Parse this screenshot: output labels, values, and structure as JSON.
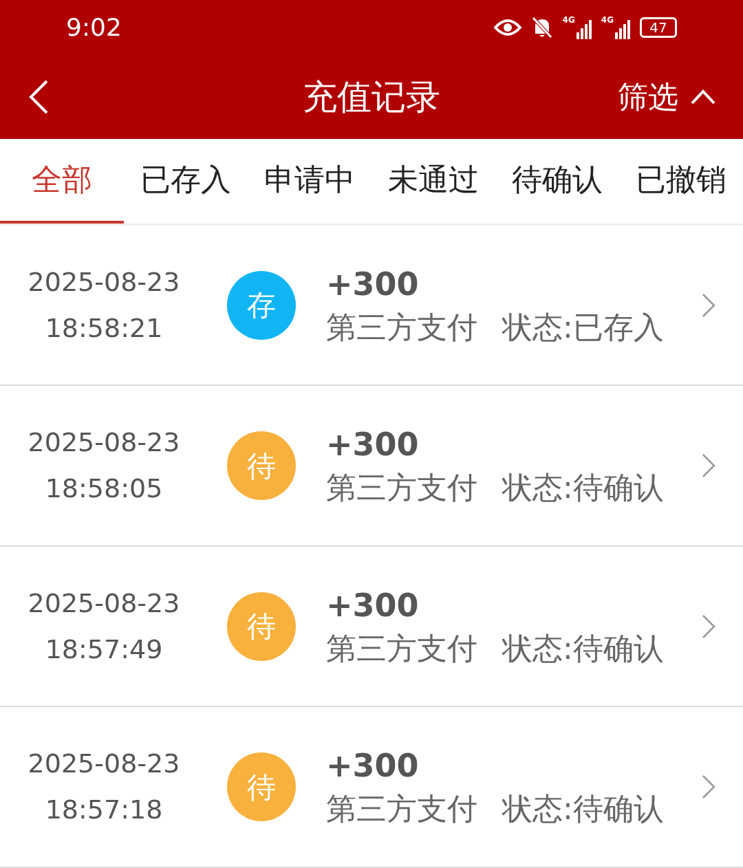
{
  "status_bar": {
    "time": "9:02",
    "battery": "47",
    "signal_labels": [
      "4G",
      "4G"
    ]
  },
  "nav": {
    "title": "充值记录",
    "filter": "筛选"
  },
  "tabs": [
    {
      "label": "全部",
      "selected": true
    },
    {
      "label": "已存入",
      "selected": false
    },
    {
      "label": "申请中",
      "selected": false
    },
    {
      "label": "未通过",
      "selected": false
    },
    {
      "label": "待确认",
      "selected": false
    },
    {
      "label": "已撤销",
      "selected": false
    }
  ],
  "records": [
    {
      "date": "2025-08-23",
      "time": "18:58:21",
      "badge": "存",
      "color": "#12b5f4",
      "amount": "+300",
      "method": "第三方支付",
      "status": "状态:已存入"
    },
    {
      "date": "2025-08-23",
      "time": "18:58:05",
      "badge": "待",
      "color": "#f8b13d",
      "amount": "+300",
      "method": "第三方支付",
      "status": "状态:待确认"
    },
    {
      "date": "2025-08-23",
      "time": "18:57:49",
      "badge": "待",
      "color": "#f8b13d",
      "amount": "+300",
      "method": "第三方支付",
      "status": "状态:待确认"
    },
    {
      "date": "2025-08-23",
      "time": "18:57:18",
      "badge": "待",
      "color": "#f8b13d",
      "amount": "+300",
      "method": "第三方支付",
      "status": "状态:待确认"
    }
  ]
}
